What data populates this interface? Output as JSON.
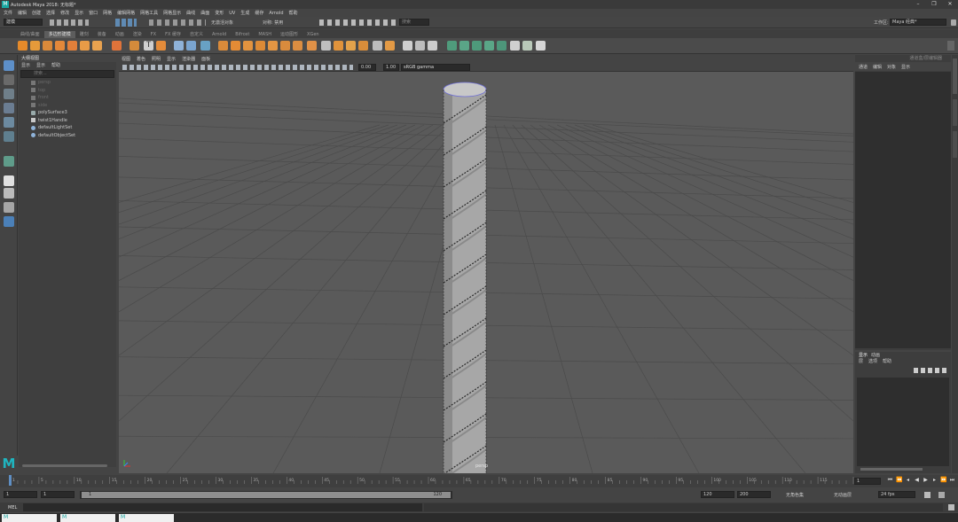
{
  "window": {
    "title": "Autodesk Maya 2018: 无标题*"
  },
  "menubar": [
    "文件",
    "编辑",
    "创建",
    "选择",
    "修改",
    "显示",
    "窗口",
    "网格",
    "编辑网格",
    "网格工具",
    "网格显示",
    "曲线",
    "曲面",
    "变形",
    "UV",
    "生成",
    "缓存",
    "Arnold",
    "帮助"
  ],
  "statusline": {
    "menu_set": "建模",
    "no_live": "无激活对象",
    "symmetry": "对称: 禁用",
    "search_hint": "搜索",
    "workspace_label": "工作区:",
    "workspace_value": "Maya 经典*"
  },
  "shelf": {
    "tabs": [
      "曲线/曲面",
      "多边形建模",
      "雕刻",
      "装备",
      "动画",
      "渲染",
      "FX",
      "FX 缓存",
      "自定义",
      "Arnold",
      "Bifrost",
      "MASH",
      "运动图形",
      "XGen"
    ],
    "active_tab": 1
  },
  "outliner": {
    "title": "大纲视图",
    "menu": [
      "显示",
      "显示",
      "帮助"
    ],
    "search_placeholder": "搜索...",
    "items": [
      {
        "label": "persp",
        "dim": true
      },
      {
        "label": "top",
        "dim": true
      },
      {
        "label": "front",
        "dim": true
      },
      {
        "label": "side",
        "dim": true
      },
      {
        "label": "polySurface3",
        "dim": false
      },
      {
        "label": "twist1Handle",
        "dim": false
      },
      {
        "label": "defaultLightSet",
        "dim": false
      },
      {
        "label": "defaultObjectSet",
        "dim": false
      }
    ]
  },
  "viewport": {
    "menu": [
      "视图",
      "着色",
      "照明",
      "显示",
      "渲染器",
      "面板"
    ],
    "value_a": "0.00",
    "value_b": "1.00",
    "color_space": "sRGB gamma",
    "camera_label": "persp"
  },
  "channel_box": {
    "tabs": [
      "通道盒/层编辑器"
    ],
    "menu": [
      "通道",
      "编辑",
      "对象",
      "显示"
    ]
  },
  "layers": {
    "tabs": [
      "显示",
      "动画"
    ],
    "menu": [
      "层",
      "选项",
      "帮助"
    ]
  },
  "timeline": {
    "ticks": [
      "1",
      "5",
      "10",
      "15",
      "20",
      "25",
      "30",
      "35",
      "40",
      "45",
      "50",
      "55",
      "60",
      "65",
      "70",
      "75",
      "80",
      "85",
      "90",
      "95",
      "100",
      "105",
      "110",
      "115",
      "120"
    ],
    "current_frame": "1"
  },
  "range": {
    "start": "1",
    "inner_start": "1",
    "inner_start_bar": "1",
    "inner_end_bar": "120",
    "inner_end": "120",
    "end": "200",
    "char_set": "无角色集",
    "anim_layer": "无动画层",
    "fps": "24 fps"
  },
  "cmdline": {
    "label": "MEL"
  },
  "taskbar": [
    "M",
    "M",
    "M"
  ]
}
